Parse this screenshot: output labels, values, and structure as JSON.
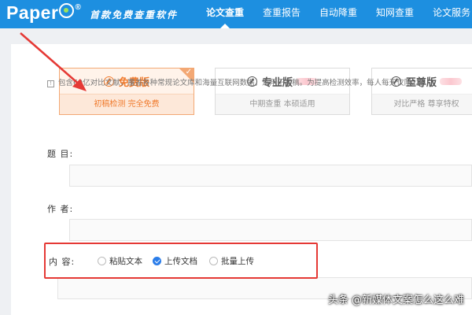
{
  "header": {
    "logo_text": "Paper",
    "logo_reg": "®",
    "slogan": "首款免费查重软件",
    "nav": [
      "论文查重",
      "查重报告",
      "自动降重",
      "知网查重",
      "论文服务"
    ],
    "active_nav": "论文查重",
    "bg_color": "#1d8fe0"
  },
  "versions": [
    {
      "name": "免费版",
      "desc": "初稿检测 完全免费",
      "icon": "forbidden-icon",
      "selected": true
    },
    {
      "name": "专业版",
      "desc": "中期查重 本硕适用",
      "icon": "compass-icon",
      "selected": false
    },
    {
      "name": "至尊版",
      "desc": "对比严格 尊享特权",
      "icon": "crown-icon",
      "selected": false
    }
  ],
  "info_text": "包含60亿对比文献，覆盖各种常规论文库和海量互联网数据，适用于初稿。为提高检测效率，每人每天仅限2篇",
  "form": {
    "title_label": "题 目:",
    "author_label": "作 者:",
    "content_label": "内 容:",
    "content_options": [
      {
        "label": "粘贴文本",
        "checked": false
      },
      {
        "label": "上传文档",
        "checked": true
      },
      {
        "label": "批量上传",
        "checked": false
      }
    ]
  },
  "watermark": "头条 @新媒体文案怎么这么难",
  "colors": {
    "accent": "#f07a2c",
    "highlight": "#e53935",
    "radio_checked": "#2b7de9"
  }
}
